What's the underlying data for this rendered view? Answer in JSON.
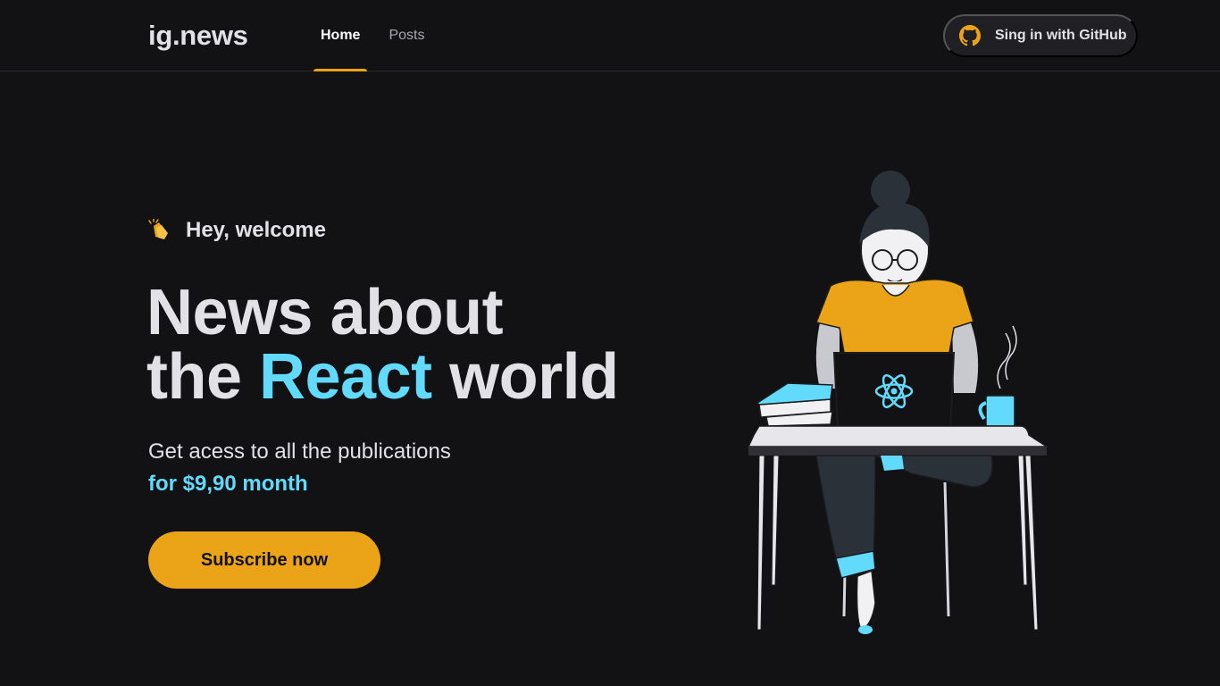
{
  "header": {
    "logo": "ig.news",
    "nav": [
      {
        "label": "Home",
        "active": true
      },
      {
        "label": "Posts",
        "active": false
      }
    ],
    "signin_label": "Sing in with GitHub",
    "signin_icon": "github-icon",
    "signin_icon_color": "#eba417"
  },
  "hero": {
    "welcome_icon": "clapping-hands-icon",
    "welcome": "Hey, welcome",
    "headline_line1": "News about",
    "headline_the": "the",
    "headline_accent": "React",
    "headline_world": "world",
    "description": "Get acess to all the publications",
    "price": "for $9,90 month",
    "subscribe_label": "Subscribe now",
    "illustration": "woman-at-desk-with-react-laptop-illustration"
  },
  "colors": {
    "background": "#121214",
    "accent_yellow": "#eba417",
    "accent_cyan": "#61dafb",
    "text": "#e1e1e6"
  }
}
